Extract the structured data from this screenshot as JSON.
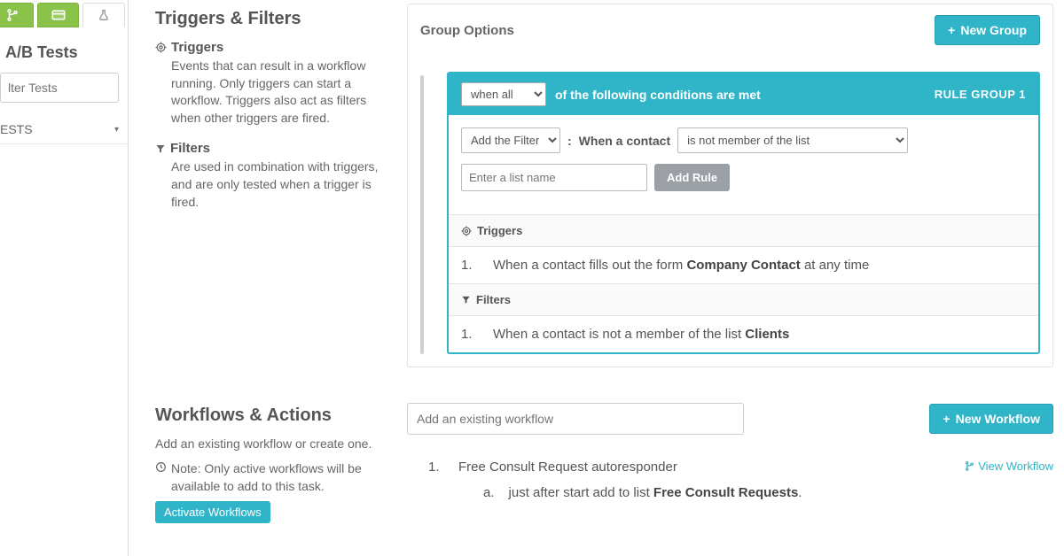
{
  "sidebar": {
    "title": "A/B Tests",
    "filter_placeholder": "lter Tests",
    "rows": [
      {
        "label": "ESTS"
      }
    ]
  },
  "info": {
    "tf_title": "Triggers & Filters",
    "triggers_label": "Triggers",
    "triggers_text": "Events that can result in a workflow running. Only triggers can start a workflow. Triggers also act as filters when other triggers are fired.",
    "filters_label": "Filters",
    "filters_text": "Are used in combination with triggers, and are only tested when a trigger is fired.",
    "wa_title": "Workflows & Actions",
    "wa_text": "Add an existing workflow or create one.",
    "note_text": "Note: Only active workflows will be available to add to this task.",
    "activate_btn": "Activate Workflows"
  },
  "panel": {
    "group_options": "Group Options",
    "new_group": "New Group",
    "rg": {
      "when_selected": "when all",
      "when_suffix": "of the following conditions are met",
      "group_label": "RULE GROUP 1",
      "filter_select": "Add the Filter",
      "contact_label": "When a contact",
      "membership_select": "is not member of the list",
      "list_placeholder": "Enter a list name",
      "add_rule": "Add Rule",
      "triggers_head": "Triggers",
      "trigger1_num": "1.",
      "trigger1_pre": "When a contact fills out the form ",
      "trigger1_bold": "Company Contact",
      "trigger1_post": " at any time",
      "filters_head": "Filters",
      "filter1_num": "1.",
      "filter1_pre": "When a contact is not a member of the list ",
      "filter1_bold": "Clients"
    }
  },
  "workflows": {
    "add_placeholder": "Add an existing workflow",
    "new_workflow": "New Workflow",
    "view_workflow": "View Workflow",
    "item1_num": "1.",
    "item1_title": "Free Consult Request autoresponder",
    "sub_a_letter": "a.",
    "sub_a_pre": "just after start add to list ",
    "sub_a_bold": "Free Consult Requests",
    "sub_a_post": "."
  }
}
